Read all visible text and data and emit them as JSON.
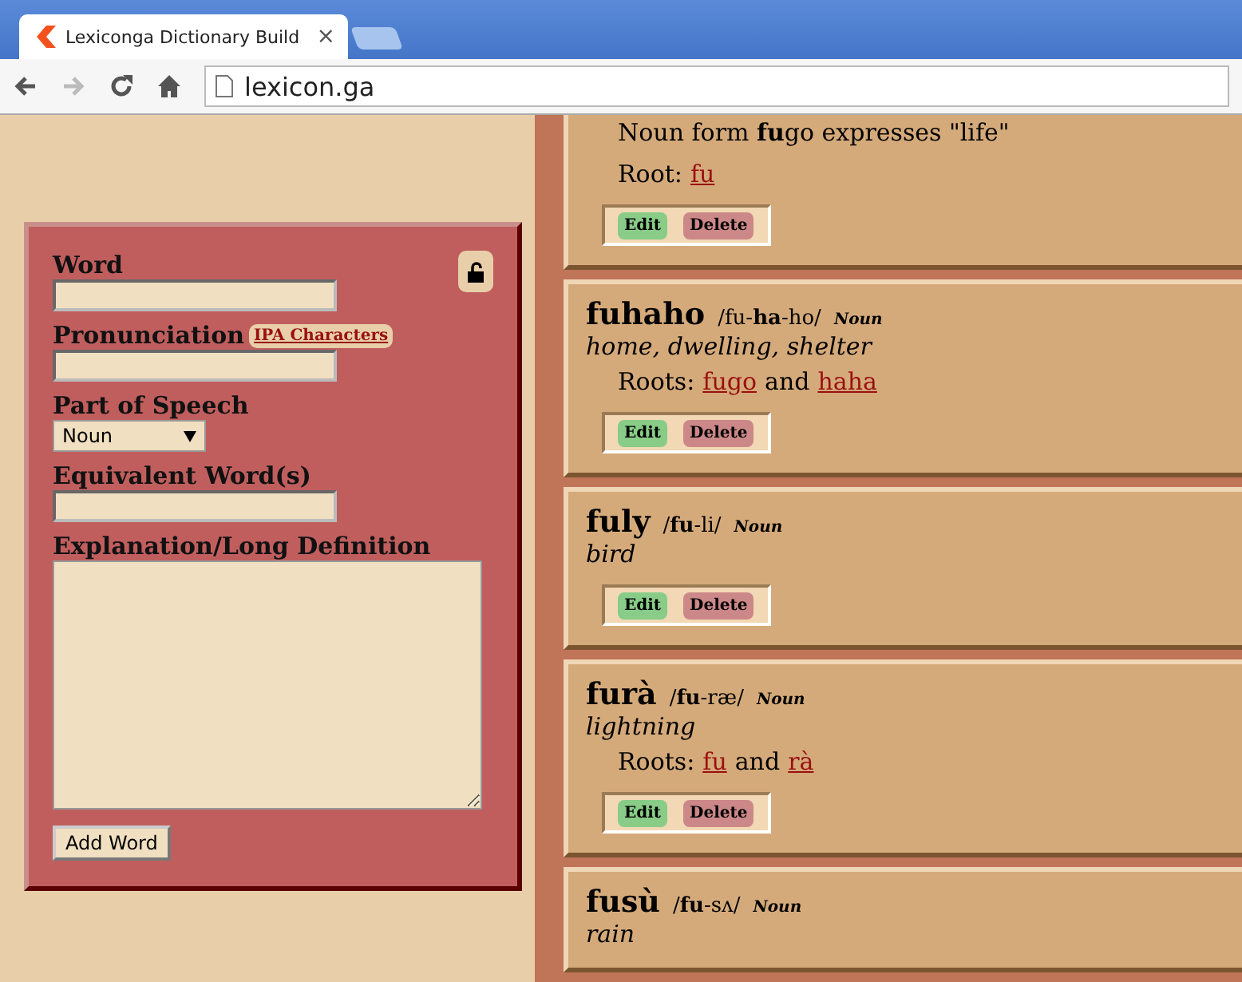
{
  "browser": {
    "tab_title": "Lexiconga Dictionary Build",
    "tab_close": "×",
    "address": "lexicon.ga"
  },
  "form": {
    "fields": [
      {
        "kind": "text",
        "label": "Word"
      },
      {
        "kind": "text",
        "label": "Pronunciation",
        "link": "IPA Characters"
      },
      {
        "kind": "select",
        "label": "Part of Speech",
        "value": "Noun"
      },
      {
        "kind": "text",
        "label": "Equivalent Word(s)"
      },
      {
        "kind": "textarea",
        "label": "Explanation/Long Definition"
      }
    ],
    "submit": "Add Word",
    "locked": false
  },
  "entries": [
    {
      "notes": [
        "Noun form **fu**go expresses \"life\""
      ],
      "roots": {
        "label": "Root:",
        "links": [
          "fu"
        ]
      },
      "buttons": [
        "Edit",
        "Delete"
      ]
    },
    {
      "word": "fuhaho",
      "pronunciation": "/fu-**ha**-ho/",
      "part_of_speech": "Noun",
      "definition": "home, dwelling, shelter",
      "roots": {
        "label": "Roots:",
        "links": [
          "fugo",
          "haha"
        ],
        "joiner": "and"
      },
      "buttons": [
        "Edit",
        "Delete"
      ]
    },
    {
      "word": "fuly",
      "pronunciation": "/**fu**-li/",
      "part_of_speech": "Noun",
      "definition": "bird",
      "buttons": [
        "Edit",
        "Delete"
      ]
    },
    {
      "word": "furà",
      "pronunciation": "/**fu**-ræ/",
      "part_of_speech": "Noun",
      "definition": "lightning",
      "roots": {
        "label": "Roots:",
        "links": [
          "fu",
          "rà"
        ],
        "joiner": "and"
      },
      "buttons": [
        "Edit",
        "Delete"
      ]
    },
    {
      "word": "fusù",
      "pronunciation": "/**fu**-sʌ/",
      "part_of_speech": "Noun",
      "definition": "rain"
    }
  ]
}
